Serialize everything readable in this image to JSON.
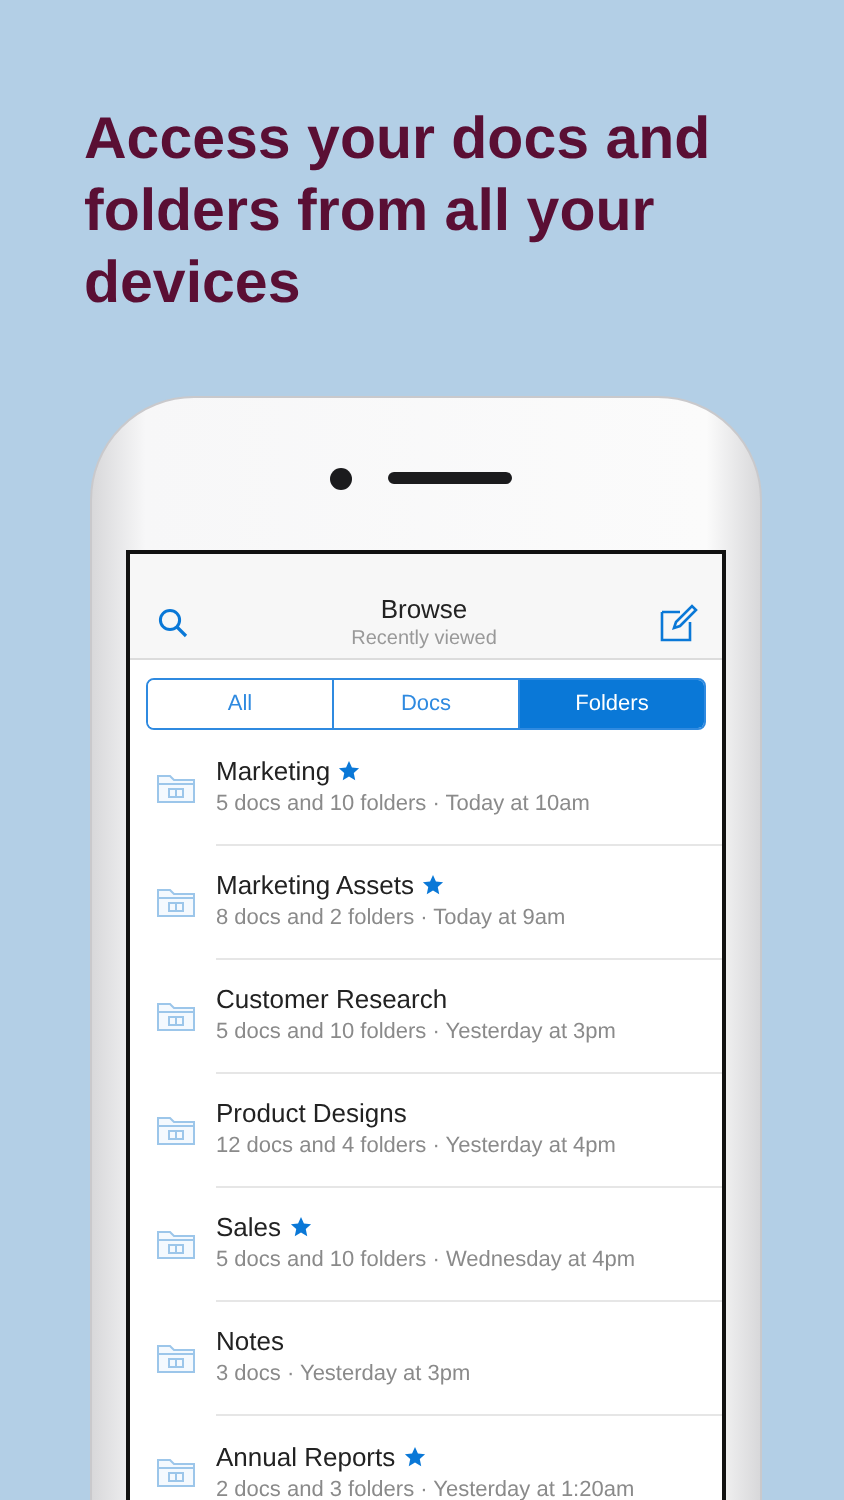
{
  "headline": "Access your docs and folders from all your devices",
  "header": {
    "title": "Browse",
    "subtitle": "Recently viewed"
  },
  "tabs": [
    {
      "label": "All",
      "selected": false
    },
    {
      "label": "Docs",
      "selected": false
    },
    {
      "label": "Folders",
      "selected": true
    }
  ],
  "folders": [
    {
      "name": "Marketing",
      "starred": true,
      "details": "5 docs and 10 folders · Today at 10am"
    },
    {
      "name": "Marketing Assets",
      "starred": true,
      "details": "8 docs and 2 folders · Today at 9am"
    },
    {
      "name": "Customer Research",
      "starred": false,
      "details": "5 docs and 10 folders · Yesterday at 3pm"
    },
    {
      "name": "Product Designs",
      "starred": false,
      "details": "12 docs and 4 folders · Yesterday at 4pm"
    },
    {
      "name": "Sales",
      "starred": true,
      "details": "5 docs and 10 folders · Wednesday at 4pm"
    },
    {
      "name": "Notes",
      "starred": false,
      "details": "3 docs · Yesterday at 3pm"
    },
    {
      "name": "Annual Reports",
      "starred": true,
      "details": "2 docs and 3 folders · Yesterday at 1:20am"
    }
  ]
}
